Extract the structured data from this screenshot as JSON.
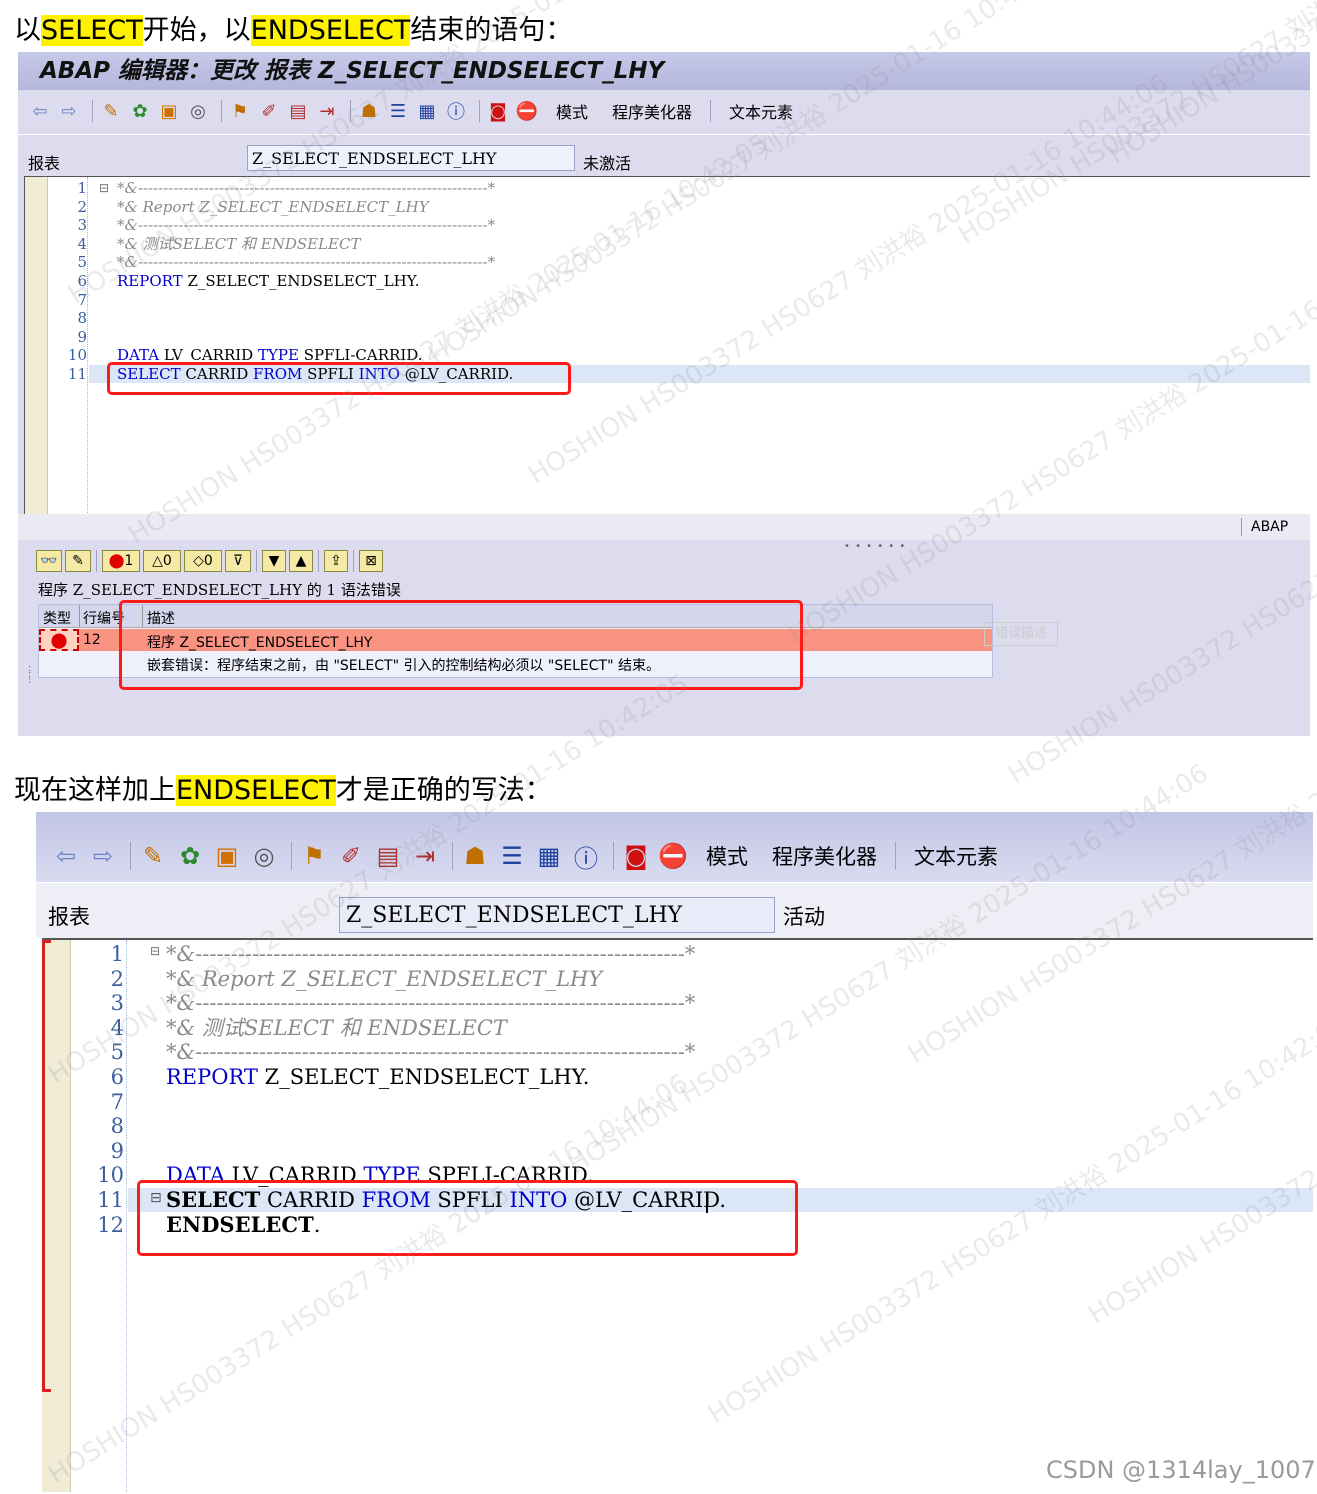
{
  "heading1": {
    "pre": "以",
    "hl1": "SELECT",
    "mid": "开始，以",
    "hl2": "ENDSELECT",
    "post": "结束的语句："
  },
  "heading2": {
    "pre": "现在这样加上",
    "hl": "ENDSELECT",
    "post": "才是正确的写法："
  },
  "panel1": {
    "title": "ABAP 编辑器：更改 报表 Z_SELECT_ENDSELECT_LHY",
    "toolbar_texts": [
      "模式",
      "程序美化器",
      "文本元素"
    ],
    "report_label": "报表",
    "report_value": "Z_SELECT_ENDSELECT_LHY",
    "status": "未激活",
    "lines": [
      {
        "n": "1",
        "c": "*&---------------------------------------------------------------------*"
      },
      {
        "n": "2",
        "c": "*& Report Z_SELECT_ENDSELECT_LHY"
      },
      {
        "n": "3",
        "c": "*&---------------------------------------------------------------------*"
      },
      {
        "n": "4",
        "c": "*& 测试SELECT 和 ENDSELECT"
      },
      {
        "n": "5",
        "c": "*&---------------------------------------------------------------------*"
      },
      {
        "n": "6",
        "k": "REPORT",
        "r": " Z_SELECT_ENDSELECT_LHY."
      },
      {
        "n": "7"
      },
      {
        "n": "8"
      },
      {
        "n": "9"
      },
      {
        "n": "10",
        "k": "DATA",
        "r": " LV_CARRID ",
        "k2": "TYPE",
        "r2": " SPFLI-CARRID."
      },
      {
        "n": "11",
        "k": "SELECT",
        "r": " CARRID ",
        "k2": "FROM",
        "r2": " SPFLI ",
        "k3": "INTO",
        "r3": " @LV_CARRID."
      }
    ],
    "lang": "ABAP",
    "err_counts": {
      "errors": "1",
      "warnings": "0",
      "info": "0"
    },
    "err_summary": "程序 Z_SELECT_ENDSELECT_LHY 的 1 语法错误",
    "err_cols": {
      "type": "类型",
      "line": "行编号",
      "desc": "描述"
    },
    "err_row": {
      "line": "12",
      "program": "程序 Z_SELECT_ENDSELECT_LHY",
      "message": "嵌套错误：程序结束之前，由 \"SELECT\" 引入的控制结构必须以 \"SELECT\" 结束。"
    },
    "err_tooltip": "错误描述"
  },
  "panel2": {
    "toolbar_texts": [
      "模式",
      "程序美化器",
      "文本元素"
    ],
    "report_label": "报表",
    "report_value": "Z_SELECT_ENDSELECT_LHY",
    "status": "活动",
    "lines": [
      {
        "n": "1",
        "c": "*&---------------------------------------------------------------------*"
      },
      {
        "n": "2",
        "c": "*& Report Z_SELECT_ENDSELECT_LHY"
      },
      {
        "n": "3",
        "c": "*&---------------------------------------------------------------------*"
      },
      {
        "n": "4",
        "c": "*& 测试SELECT 和 ENDSELECT"
      },
      {
        "n": "5",
        "c": "*&---------------------------------------------------------------------*"
      },
      {
        "n": "6",
        "k": "REPORT",
        "r": " Z_SELECT_ENDSELECT_LHY."
      },
      {
        "n": "7"
      },
      {
        "n": "8"
      },
      {
        "n": "9"
      },
      {
        "n": "10",
        "k": "DATA",
        "r": " LV_CARRID ",
        "k2": "TYPE",
        "r2": " SPFLI-CARRID."
      },
      {
        "n": "11",
        "b": "SELECT",
        "r": " CARRID ",
        "k2": "FROM",
        "r2": " SPFLI ",
        "k3": "INTO",
        "r3": " @LV_CARRID."
      },
      {
        "n": "12",
        "b": "ENDSELECT",
        "r": "."
      }
    ]
  },
  "watermarks": [
    "HOSHION HS003372 HS0627 刘洪裕 2025-01-16 10:42:05",
    "HOSHION HS003372 HS0627 刘洪裕 2025-01-16 10:44:06"
  ],
  "footer": "CSDN @1314lay_1007",
  "colors": {
    "highlight": "#fff200",
    "keyword": "#0000cc",
    "error_row": "#fb9383",
    "red_box": "#ff1a1a"
  }
}
